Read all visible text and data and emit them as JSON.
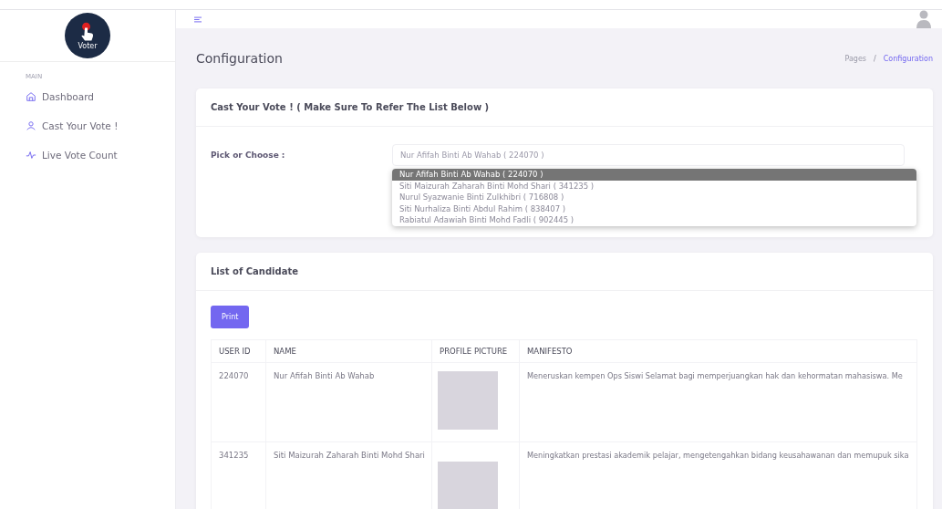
{
  "sidebar": {
    "logo_text": "Voter",
    "section": "MAIN",
    "items": [
      {
        "label": "Dashboard",
        "selected": false
      },
      {
        "label": "Cast Your Vote !",
        "selected": false
      },
      {
        "label": "Live Vote Count",
        "selected": false
      }
    ]
  },
  "page": {
    "title": "Configuration",
    "breadcrumb_separator": "/",
    "breadcrumb": [
      {
        "label": "Pages",
        "selected": false
      },
      {
        "label": "Configuration",
        "selected": true
      }
    ]
  },
  "vote_card": {
    "title": "Cast Your Vote ! ( Make Sure To Refer The List Below )",
    "field_label": "Pick or Choose :",
    "value": "Nur Afifah Binti Ab Wahab ( 224070 )",
    "options": [
      {
        "label": "Nur Afifah Binti Ab Wahab ( 224070 )",
        "selected": true
      },
      {
        "label": "Siti Maizurah Zaharah Binti Mohd Shari ( 341235 )",
        "selected": false
      },
      {
        "label": "Nurul Syazwanie Binti Zulkhibri ( 716808 )",
        "selected": false
      },
      {
        "label": "Siti Nurhaliza Binti Abdul Rahim ( 838407 )",
        "selected": false
      },
      {
        "label": "Rabiatul Adawiah Binti Mohd Fadli ( 902445 )",
        "selected": false
      }
    ]
  },
  "candidates": {
    "title": "List of Candidate",
    "print_button": "Print",
    "columns": [
      "USER ID",
      "NAME",
      "PROFILE PICTURE",
      "MANIFESTO"
    ],
    "rows": [
      {
        "user_id": "224070",
        "name": "Nur Afifah Binti Ab Wahab",
        "manifesto": "Meneruskan kempen Ops Siswi Selamat bagi memperjuangkan hak dan kehormatan mahasiswa. Me"
      },
      {
        "user_id": "341235",
        "name": "Siti Maizurah Zaharah Binti Mohd Shari",
        "manifesto": "Meningkatkan prestasi akademik pelajar, mengetengahkan bidang keusahawanan dan memupuk sika"
      }
    ]
  }
}
